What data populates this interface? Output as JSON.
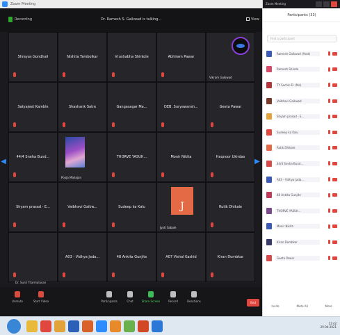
{
  "window": {
    "title": "Zoom Meeting",
    "secure_label": "Recording",
    "speaker_label": "Dr. Ramesh S. Gaikwad is talking...",
    "view_label": "View"
  },
  "tiles": [
    {
      "name": "Shreyas Gondhali",
      "has_name": true
    },
    {
      "name": "Nishita Tambolkar",
      "has_name": true
    },
    {
      "name": "Vrushabha Shirkole",
      "has_name": true
    },
    {
      "name": "Abhiram Pawar",
      "has_name": true
    },
    {
      "name": "",
      "small_label": "Vikram Gaikwad",
      "avatar": "purple"
    },
    {
      "name": "Satyajeet Kamble",
      "has_name": true
    },
    {
      "name": "Shashank Satre",
      "has_name": true
    },
    {
      "name": "Gangasagar Ma...",
      "has_name": true
    },
    {
      "name": "DEB. Suryawansh...",
      "has_name": true
    },
    {
      "name": "Geeta Pawar",
      "has_name": true
    },
    {
      "name": "44/4 Sneha Bund...",
      "has_name": true
    },
    {
      "name": "",
      "small_label": "Pooja Mahajan",
      "avatar": "photo"
    },
    {
      "name": "THORVE YASUH...",
      "has_name": true
    },
    {
      "name": "Monir Nikita",
      "has_name": true
    },
    {
      "name": "Haqnoor Ukirdas",
      "has_name": true
    },
    {
      "name": "Shyam prasad - E...",
      "has_name": true
    },
    {
      "name": "Vaibhavi Gaikw...",
      "has_name": true
    },
    {
      "name": "Sudeep ka Kalu",
      "has_name": true
    },
    {
      "name": "",
      "small_label": "Jyoti Sabale",
      "avatar": "orange",
      "avatar_letter": "J"
    },
    {
      "name": "Rutik Dhikale",
      "has_name": true
    },
    {
      "name": "",
      "has_name": false
    },
    {
      "name": "A03 - Vidhya Jada...",
      "has_name": true
    },
    {
      "name": "48 Ankita Gunjite",
      "has_name": true
    },
    {
      "name": "A07 Vishal Kashid",
      "has_name": true
    },
    {
      "name": "Kiran Dombkar",
      "has_name": true
    }
  ],
  "footer_label": "Dr. Sunil Tharmalavan",
  "controls": [
    {
      "label": "Unmute",
      "icon": "microphone-muted-icon"
    },
    {
      "label": "Start Video",
      "icon": "camera-off-icon"
    },
    {
      "label": "Participants",
      "badge": "33"
    },
    {
      "label": "Chat",
      "icon": "chat-icon"
    },
    {
      "label": "Share Screen",
      "icon": "share-screen-icon"
    },
    {
      "label": "Record",
      "icon": "record-icon"
    },
    {
      "label": "Reactions",
      "icon": "reactions-icon"
    }
  ],
  "end_label": "End",
  "panel": {
    "title": "Participants (33)",
    "search_placeholder": "Find a participant",
    "participants": [
      {
        "name": "Ramesh Gaikwad (Host)",
        "color": "#3a5bb8"
      },
      {
        "name": "Ramesh Shinde",
        "color": "#d84a6a"
      },
      {
        "name": "TY Sachin D. (Me)",
        "color": "#b5363a"
      },
      {
        "name": "Vaibhavi Gaikwad",
        "color": "#7a3a2a"
      },
      {
        "name": "Shyam prasad - E...",
        "color": "#e6a23a"
      },
      {
        "name": "Sudeep ka Kalu",
        "color": "#e0483f"
      },
      {
        "name": "Rutik Dhikale",
        "color": "#e46a45"
      },
      {
        "name": "44/4 Sneha Bund...",
        "color": "#d84a4a"
      },
      {
        "name": "A03 - Vidhya Jada...",
        "color": "#3a5bb8"
      },
      {
        "name": "48 Ankita Gunjite",
        "color": "#c23a5a"
      },
      {
        "name": "THORVE YASUH...",
        "color": "#7a4a8a"
      },
      {
        "name": "Monir Nikita",
        "color": "#3a5bb8"
      },
      {
        "name": "Kiran Dombkar",
        "color": "#3a3a6a"
      },
      {
        "name": "Geeta Pawar",
        "color": "#d84a4a"
      }
    ],
    "footer_buttons": [
      "Invite",
      "Mute All",
      "More"
    ]
  },
  "taskbar": {
    "time": "11:42",
    "date": "29-04-2021",
    "icons": [
      {
        "name": "file-explorer-icon",
        "color": "#e8b93a"
      },
      {
        "name": "chrome-icon",
        "color": "#e0483f"
      },
      {
        "name": "folder-icon",
        "color": "#e2a43a"
      },
      {
        "name": "word-icon",
        "color": "#2b5fb8"
      },
      {
        "name": "media-player-icon",
        "color": "#d9622b"
      },
      {
        "name": "zoom-icon",
        "color": "#2d8cff"
      },
      {
        "name": "vlc-icon",
        "color": "#e88a2a"
      },
      {
        "name": "paint-icon",
        "color": "#6ab04c"
      },
      {
        "name": "powerpoint-icon",
        "color": "#d24726"
      },
      {
        "name": "outlook-icon",
        "color": "#2b78d6"
      }
    ]
  }
}
